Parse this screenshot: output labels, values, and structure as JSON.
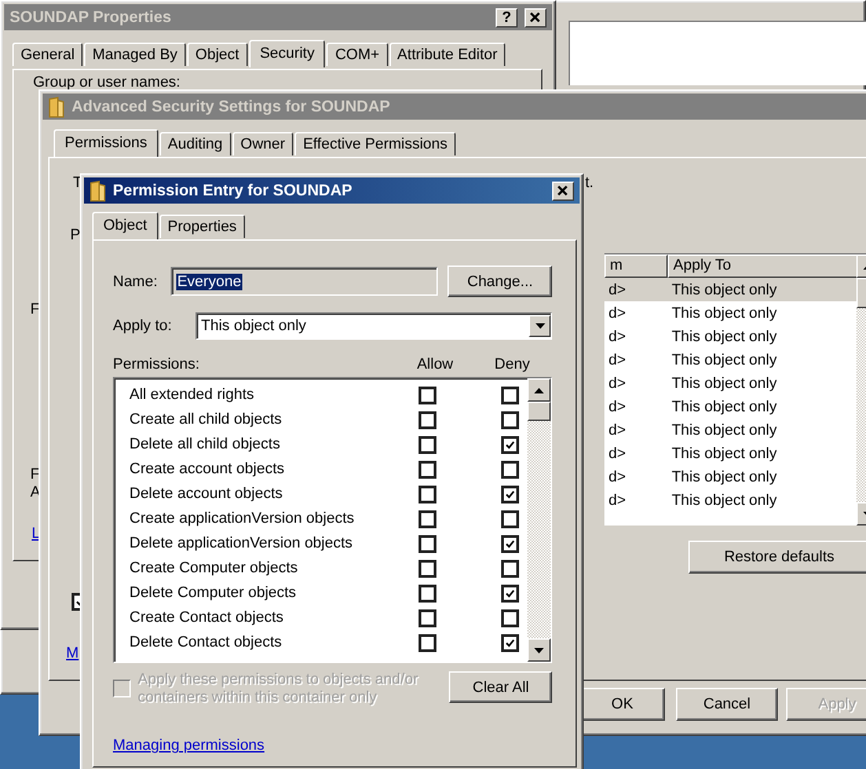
{
  "properties_window": {
    "title": "SOUNDAP Properties",
    "help_button": "?",
    "tabs": [
      {
        "label": "General",
        "selected": false
      },
      {
        "label": "Managed By",
        "selected": false
      },
      {
        "label": "Object",
        "selected": false
      },
      {
        "label": "Security",
        "selected": true
      },
      {
        "label": "COM+",
        "selected": false
      },
      {
        "label": "Attribute Editor",
        "selected": false
      }
    ],
    "group_label": "Group or user names:",
    "label_fragments": [
      "F",
      "F",
      "A"
    ],
    "link_fragment": "L"
  },
  "advanced_window": {
    "title": "Advanced Security Settings for SOUNDAP",
    "tabs": [
      {
        "label": "Permissions",
        "selected": true
      },
      {
        "label": "Auditing",
        "selected": false
      },
      {
        "label": "Owner",
        "selected": false
      },
      {
        "label": "Effective Permissions",
        "selected": false
      }
    ],
    "text_fragment_left": "T",
    "text_fragment_right": "t.",
    "entries_fragment": "P",
    "columns": [
      "m",
      "Apply To"
    ],
    "rows": [
      {
        "name": "d>",
        "apply_to": "This object only",
        "selected": true
      },
      {
        "name": "d>",
        "apply_to": "This object only",
        "selected": false
      },
      {
        "name": "d>",
        "apply_to": "This object only",
        "selected": false
      },
      {
        "name": "d>",
        "apply_to": "This object only",
        "selected": false
      },
      {
        "name": "d>",
        "apply_to": "This object only",
        "selected": false
      },
      {
        "name": "d>",
        "apply_to": "This object only",
        "selected": false
      },
      {
        "name": "d>",
        "apply_to": "This object only",
        "selected": false
      },
      {
        "name": "d>",
        "apply_to": "This object only",
        "selected": false
      },
      {
        "name": "d>",
        "apply_to": "This object only",
        "selected": false
      },
      {
        "name": "d>",
        "apply_to": "This object only",
        "selected": false
      }
    ],
    "restore_button": "Restore defaults",
    "inherit_checked": true,
    "link_fragment": "M",
    "buttons": [
      {
        "label": "OK",
        "disabled": false
      },
      {
        "label": "Cancel",
        "disabled": false
      },
      {
        "label": "Apply",
        "disabled": true
      }
    ]
  },
  "dialog": {
    "title": "Permission Entry for SOUNDAP",
    "tabs": [
      {
        "label": "Object",
        "selected": true
      },
      {
        "label": "Properties",
        "selected": false
      }
    ],
    "name_label": "Name:",
    "name_value": "Everyone",
    "change_button": "Change...",
    "apply_label": "Apply to:",
    "apply_value": "This object only",
    "permissions_label": "Permissions:",
    "allow_header": "Allow",
    "deny_header": "Deny",
    "permissions": [
      {
        "label": "All extended rights",
        "allow": false,
        "deny": false
      },
      {
        "label": "Create all child objects",
        "allow": false,
        "deny": false
      },
      {
        "label": "Delete all child objects",
        "allow": false,
        "deny": true
      },
      {
        "label": "Create account objects",
        "allow": false,
        "deny": false
      },
      {
        "label": "Delete account objects",
        "allow": false,
        "deny": true
      },
      {
        "label": "Create applicationVersion objects",
        "allow": false,
        "deny": false
      },
      {
        "label": "Delete applicationVersion objects",
        "allow": false,
        "deny": true
      },
      {
        "label": "Create Computer objects",
        "allow": false,
        "deny": false
      },
      {
        "label": "Delete Computer objects",
        "allow": false,
        "deny": true
      },
      {
        "label": "Create Contact objects",
        "allow": false,
        "deny": false
      },
      {
        "label": "Delete Contact objects",
        "allow": false,
        "deny": true
      }
    ],
    "apply_inherit": {
      "label": "Apply these permissions to objects and/or containers within this container only",
      "checked": false,
      "disabled": true
    },
    "clear_button": "Clear All",
    "link": "Managing permissions"
  }
}
